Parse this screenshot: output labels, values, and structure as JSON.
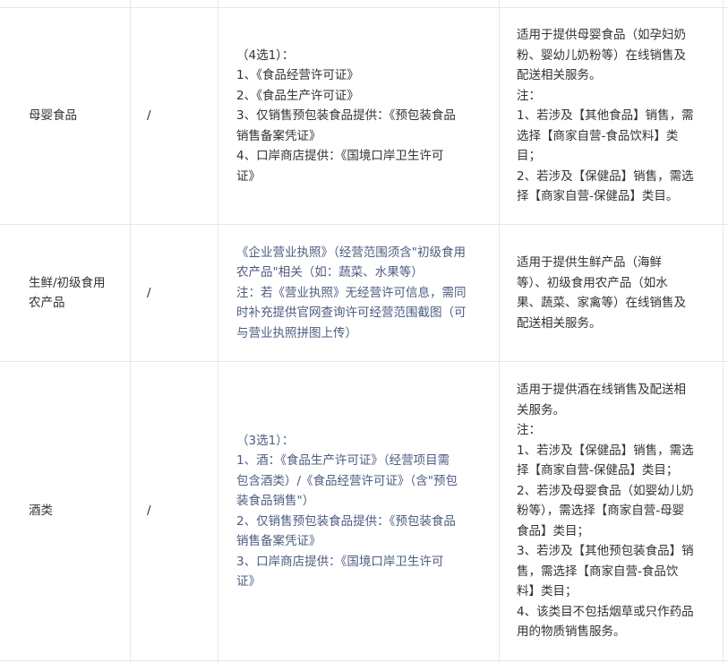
{
  "rows": [
    {
      "category_lines": [
        "母婴食品"
      ],
      "sub": "/",
      "quals_color": "#333333",
      "quals_lines": [
        "（4选1）：",
        "1、《食品经营许可证》",
        "2、《食品生产许可证》",
        "3、仅销售预包装食品提供：《预包装食品",
        "销售备案凭证》",
        "4、口岸商店提供：《国境口岸卫生许可",
        "证》"
      ],
      "desc_lines": [
        "适用于提供母婴食品（如孕妇奶",
        "粉、婴幼儿奶粉等）在线销售及",
        "配送相关服务。",
        "注：",
        "1、若涉及【其他食品】销售，需",
        "选择【商家自营-食品饮料】类",
        "目；",
        "2、若涉及【保健品】销售，需选",
        "择【商家自营-保健品】类目。"
      ]
    },
    {
      "category_lines": [
        "生鲜/初级食用",
        "农产品"
      ],
      "sub": "/",
      "quals_color": "#4d5d80",
      "quals_lines": [
        "《企业营业执照》（经营范围须含\"初级食用",
        "农产品\"相关（如：蔬菜、水果等）",
        "注：若《营业执照》无经营许可信息，需同",
        "时补充提供官网查询许可经营范围截图（可",
        "与营业执照拼图上传）"
      ],
      "desc_lines": [
        "适用于提供生鲜产品（海鲜",
        "等）、初级食用农产品（如水",
        "果、蔬菜、家禽等）在线销售及",
        "配送相关服务。"
      ]
    },
    {
      "category_lines": [
        "酒类"
      ],
      "sub": "/",
      "quals_color": "#4d5d80",
      "quals_lines": [
        "（3选1）：",
        "1、酒：《食品生产许可证》（经营项目需",
        "包含酒类）/《食品经营许可证》（含\"预包",
        "装食品销售\"）",
        "2、仅销售预包装食品提供：《预包装食品",
        "销售备案凭证》",
        "3、口岸商店提供：《国境口岸卫生许可",
        "证》"
      ],
      "desc_lines": [
        "适用于提供酒在线销售及配送相",
        "关服务。",
        "注：",
        "1、若涉及【保健品】销售，需选",
        "择【商家自营-保健品】类目；",
        "2、若涉及母婴食品（如婴幼儿奶",
        "粉等），需选择【商家自营-母婴",
        "食品】类目；",
        "3、若涉及【其他预包装食品】销",
        "售，需选择【商家自营-食品饮",
        "料】类目；",
        "4、该类目不包括烟草或只作药品",
        "用的物质销售服务。"
      ]
    }
  ]
}
